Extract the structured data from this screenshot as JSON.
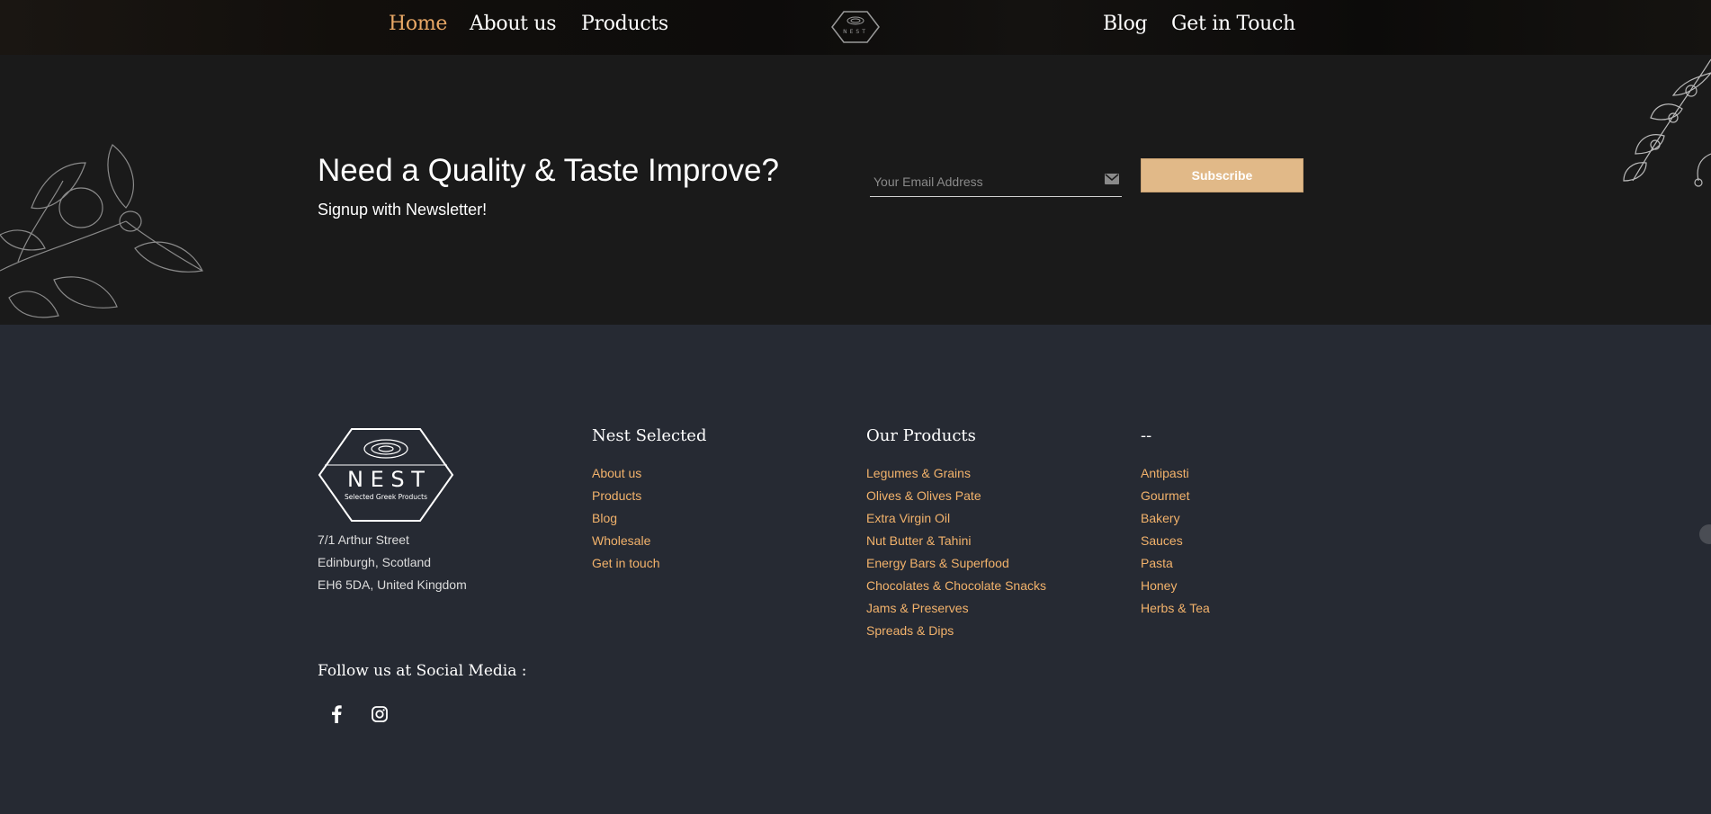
{
  "nav": {
    "items_left": [
      "Home",
      "About us",
      "Products"
    ],
    "items_right": [
      "Blog",
      "Get in Touch"
    ],
    "active": "Home",
    "logo_icon": "nest-logo-icon"
  },
  "newsletter": {
    "title": "Need a Quality & Taste Improve?",
    "subtitle": "Signup with Newsletter!",
    "email_placeholder": "Your Email Address",
    "email_value": "",
    "subscribe_label": "Subscribe",
    "email_icon": "envelope-icon"
  },
  "footer": {
    "logo_text": "N E S T",
    "logo_tagline": "Selected Greek Products",
    "address": [
      "7/1 Arthur Street",
      "Edinburgh, Scotland",
      "EH6 5DA, United Kingdom"
    ],
    "columns": [
      {
        "title": "Nest Selected",
        "links": [
          "About us",
          "Products",
          "Blog",
          "Wholesale",
          "Get in touch"
        ]
      },
      {
        "title": "Our Products",
        "links": [
          "Legumes & Grains",
          "Olives & Olives Pate",
          "Extra Virgin Oil",
          "Nut Butter & Tahini",
          "Energy Bars & Superfood",
          "Chocolates & Chocolate Snacks",
          "Jams & Preserves",
          "Spreads & Dips"
        ]
      },
      {
        "title": "--",
        "links": [
          "Antipasti",
          "Gourmet",
          "Bakery",
          "Sauces",
          "Pasta",
          "Honey",
          "Herbs & Tea"
        ]
      }
    ],
    "social_title": "Follow us at Social Media :",
    "social_icons": [
      "facebook-icon",
      "instagram-icon"
    ]
  },
  "colors": {
    "accent": "#e9a866",
    "link": "#f2b26b",
    "button": "#e1b988",
    "newsletter_bg": "#1a1a1a",
    "footer_bg": "#262a33"
  }
}
